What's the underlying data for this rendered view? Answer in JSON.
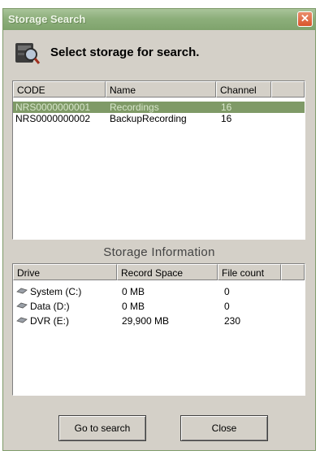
{
  "window": {
    "title": "Storage Search",
    "close_glyph": "✕"
  },
  "header": {
    "icon": "storage-search-icon",
    "text": "Select storage for search."
  },
  "storage_list": {
    "columns": [
      "CODE",
      "Name",
      "Channel"
    ],
    "rows": [
      {
        "code": "NRS0000000001",
        "name": "Recordings",
        "channel": "16",
        "selected": true
      },
      {
        "code": "NRS0000000002",
        "name": "BackupRecording",
        "channel": "16",
        "selected": false
      }
    ]
  },
  "info": {
    "title": "Storage Information",
    "columns": [
      "Drive",
      "Record Space",
      "File count"
    ],
    "rows": [
      {
        "icon": "drive-icon",
        "drive": "System (C:)",
        "space": "0 MB",
        "count": "0"
      },
      {
        "icon": "drive-icon",
        "drive": "Data (D:)",
        "space": "0 MB",
        "count": "0"
      },
      {
        "icon": "drive-icon",
        "drive": "DVR (E:)",
        "space": "29,900 MB",
        "count": "230"
      }
    ]
  },
  "buttons": {
    "search": "Go to search",
    "close": "Close"
  },
  "colors": {
    "titlebar": "#8daf7b",
    "selection": "#7f9a67",
    "close": "#d9552b"
  }
}
